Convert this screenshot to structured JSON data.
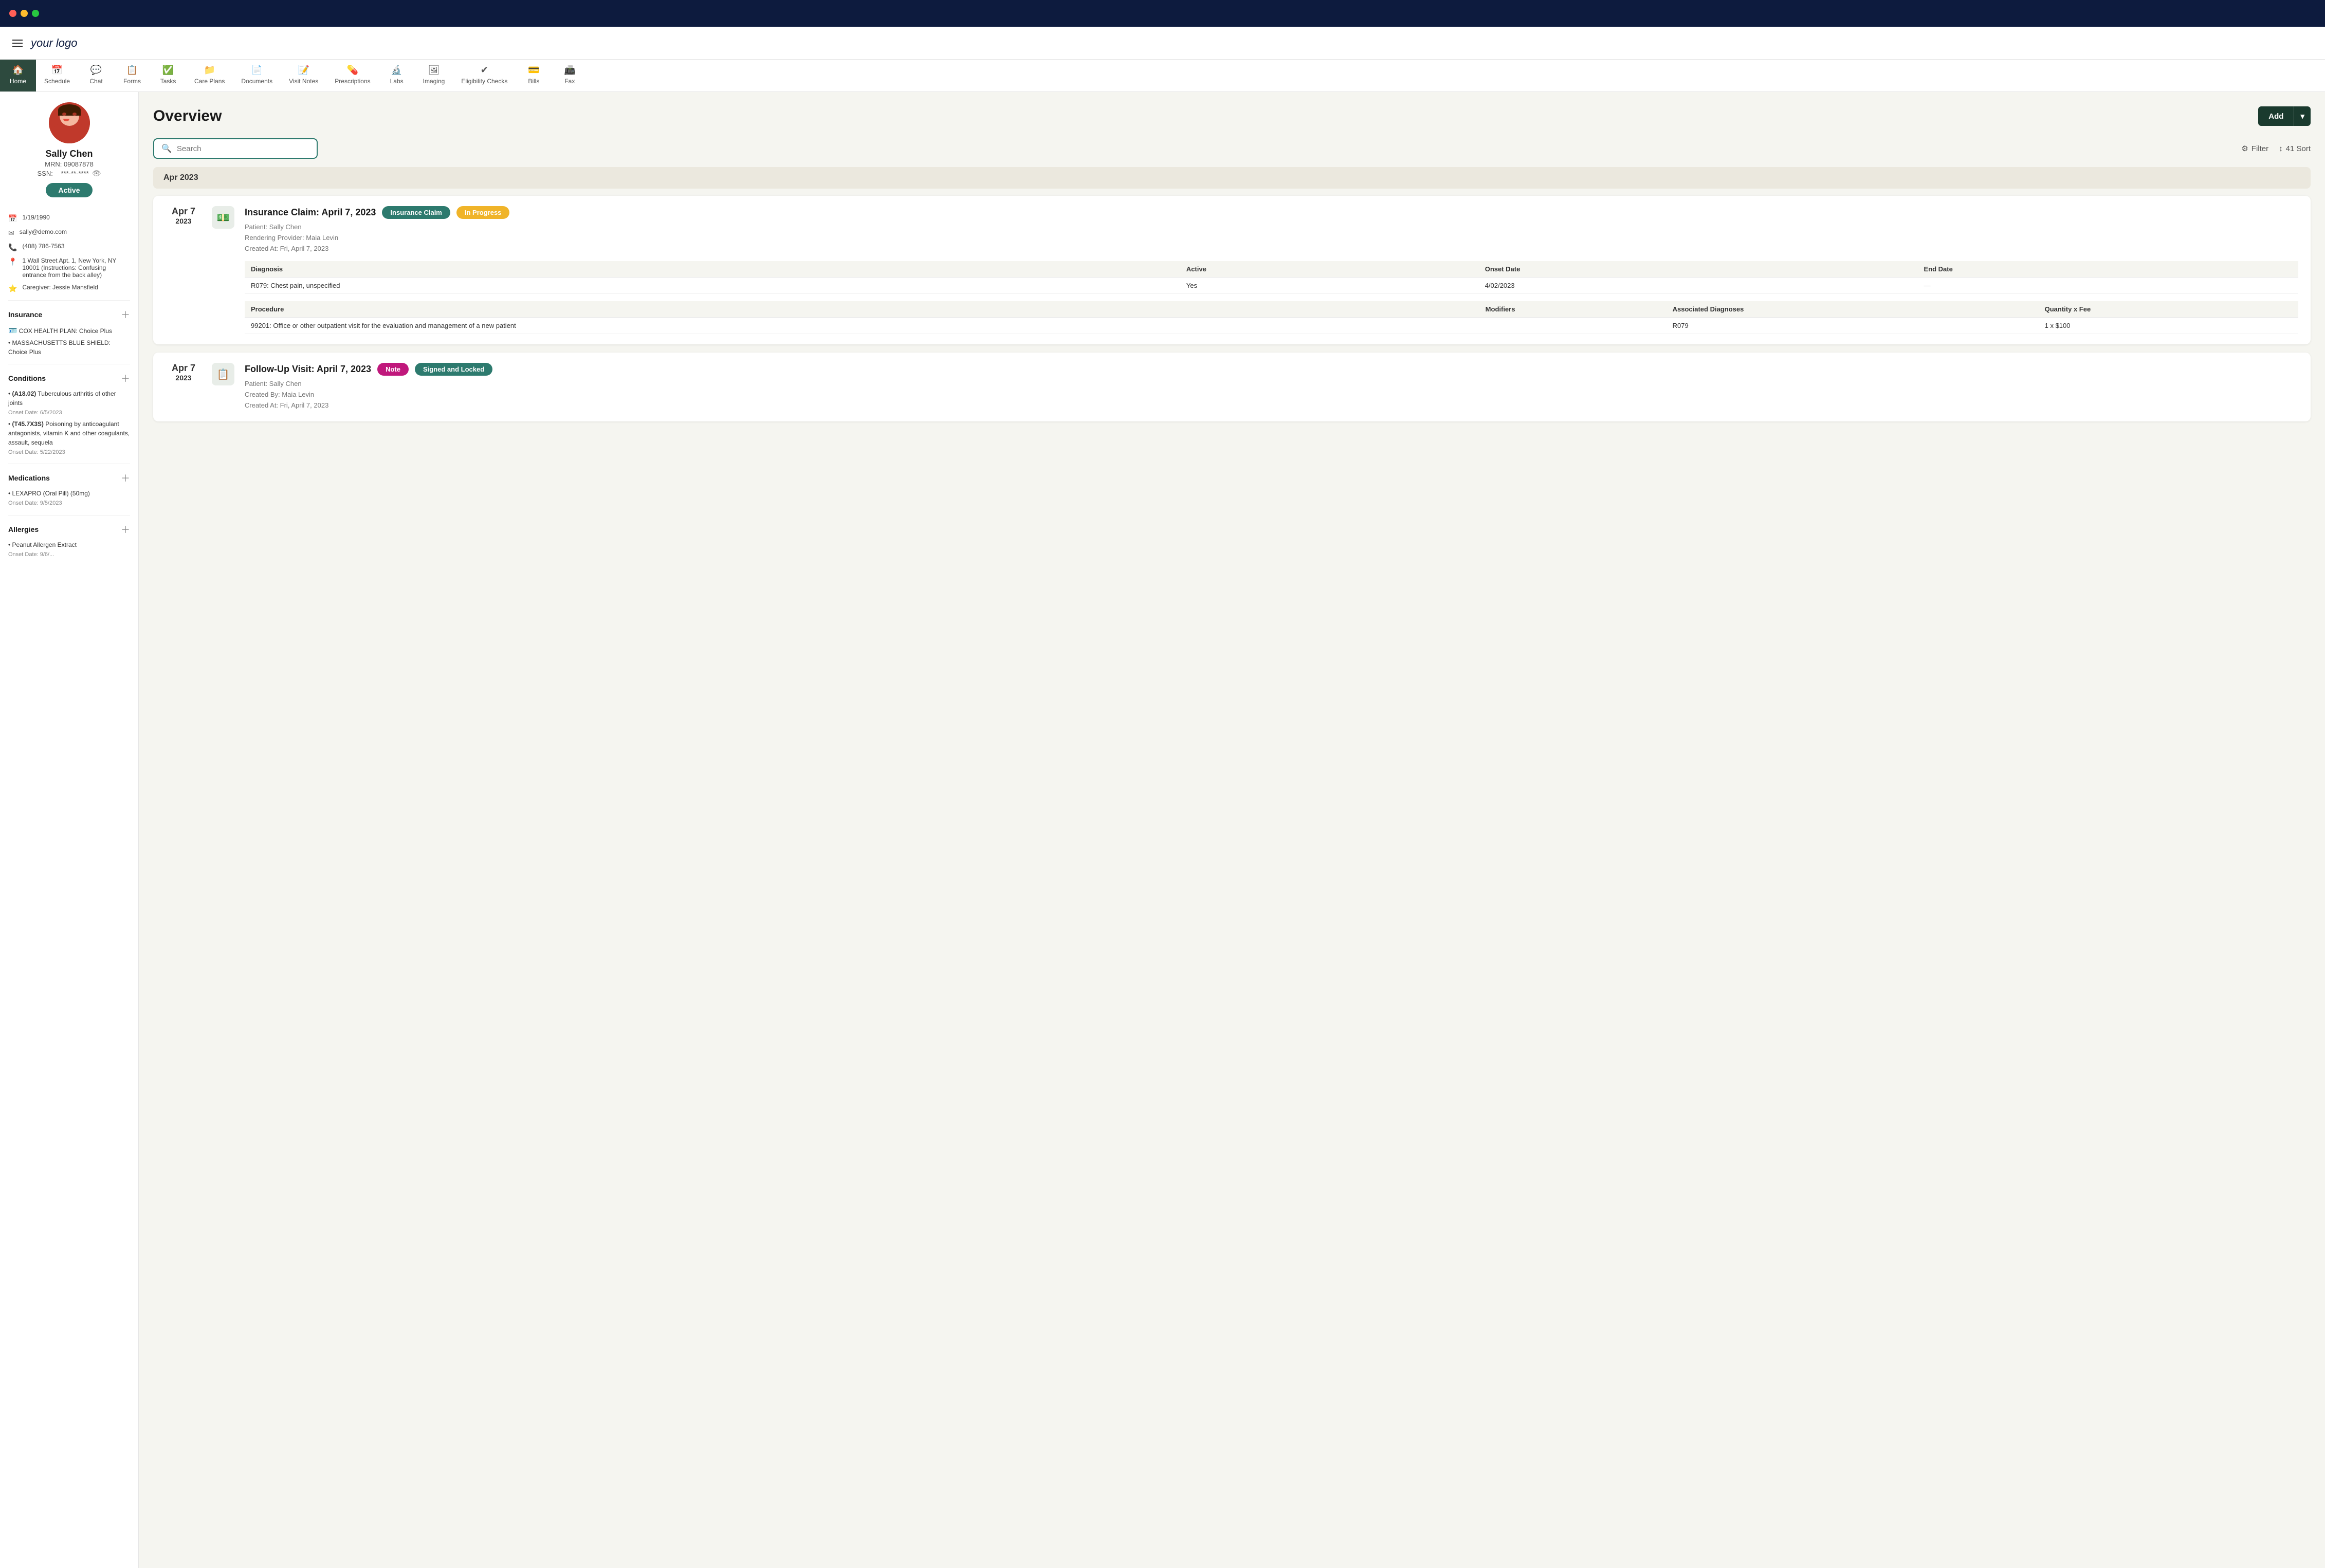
{
  "titlebar": {
    "buttons": [
      "close",
      "minimize",
      "maximize"
    ]
  },
  "topbar": {
    "logo": "your logo"
  },
  "nav": {
    "tabs": [
      {
        "id": "home",
        "label": "Home",
        "icon": "🏠",
        "active": true
      },
      {
        "id": "schedule",
        "label": "Schedule",
        "icon": "📅"
      },
      {
        "id": "chat",
        "label": "Chat",
        "icon": "💬"
      },
      {
        "id": "forms",
        "label": "Forms",
        "icon": "📋"
      },
      {
        "id": "tasks",
        "label": "Tasks",
        "icon": "✅"
      },
      {
        "id": "care-plans",
        "label": "Care Plans",
        "icon": "📁"
      },
      {
        "id": "documents",
        "label": "Documents",
        "icon": "📄"
      },
      {
        "id": "visit-notes",
        "label": "Visit Notes",
        "icon": "📝"
      },
      {
        "id": "prescriptions",
        "label": "Prescriptions",
        "icon": "💊"
      },
      {
        "id": "labs",
        "label": "Labs",
        "icon": "🔬"
      },
      {
        "id": "imaging",
        "label": "Imaging",
        "icon": "🖼"
      },
      {
        "id": "eligibility-checks",
        "label": "Eligibility Checks",
        "icon": "✔"
      },
      {
        "id": "bills",
        "label": "Bills",
        "icon": "💳"
      },
      {
        "id": "fax",
        "label": "Fax",
        "icon": "📠"
      }
    ]
  },
  "patient": {
    "name": "Sally Chen",
    "mrn_label": "MRN:",
    "mrn": "09087878",
    "ssn_label": "SSN:",
    "ssn": "***-**-****",
    "status": "Active",
    "dob": "1/19/1990",
    "email": "sally@demo.com",
    "phone": "(408) 786-7563",
    "address": "1 Wall Street Apt. 1, New York, NY 10001 (Instructions: Confusing entrance from the back alley)",
    "caregiver": "Caregiver: Jessie Mansfield"
  },
  "sidebar_sections": {
    "insurance": {
      "title": "Insurance",
      "items": [
        "COX HEALTH PLAN: Choice Plus",
        "MASSACHUSETTS BLUE SHIELD: Choice Plus"
      ]
    },
    "conditions": {
      "title": "Conditions",
      "items": [
        {
          "code": "A18.02",
          "desc": "Tuberculous arthritis of other joints",
          "onset": "Onset Date: 6/5/2023"
        },
        {
          "code": "T45.7X3S",
          "desc": "Poisoning by anticoagulant antagonists, vitamin K and other coagulants, assault, sequela",
          "onset": "Onset Date: 5/22/2023"
        }
      ]
    },
    "medications": {
      "title": "Medications",
      "items": [
        {
          "name": "LEXAPRO (Oral Pill) (50mg)",
          "onset": "Onset Date: 9/5/2023"
        }
      ]
    },
    "allergies": {
      "title": "Allergies",
      "items": [
        {
          "name": "Peanut Allergen Extract",
          "onset": "Onset Date: 9/6/..."
        }
      ]
    }
  },
  "overview": {
    "title": "Overview",
    "add_label": "Add",
    "search_placeholder": "Search",
    "filter_label": "Filter",
    "sort_label": "41 Sort",
    "date_group": "Apr 2023",
    "cards": [
      {
        "date_label": "Apr 7",
        "date_sub": "2023",
        "icon": "💵",
        "title": "Insurance Claim: April 7, 2023",
        "badge1": "Insurance Claim",
        "badge2": "In Progress",
        "patient": "Patient: Sally Chen",
        "provider": "Rendering Provider: Maia Levin",
        "created": "Created At: Fri, April 7, 2023",
        "diagnosis_table": {
          "headers": [
            "Diagnosis",
            "Active",
            "Onset Date",
            "End Date"
          ],
          "rows": [
            {
              "diagnosis": "R079: Chest pain, unspecified",
              "active": "Yes",
              "onset": "4/02/2023",
              "end": "—"
            }
          ]
        },
        "procedure_table": {
          "headers": [
            "Procedure",
            "Modifiers",
            "Associated Diagnoses",
            "Quantity x Fee"
          ],
          "rows": [
            {
              "procedure": "99201: Office or other outpatient visit for the evaluation and management of a new patient",
              "modifiers": "",
              "diagnoses": "R079",
              "fee": "1 x $100"
            }
          ]
        }
      },
      {
        "date_label": "Apr 7",
        "date_sub": "2023",
        "icon": "📋",
        "title": "Follow-Up Visit: April 7, 2023",
        "badge1": "Note",
        "badge2": "Signed and Locked",
        "patient": "Patient: Sally Chen",
        "provider": "Created By: Maia Levin",
        "created": "Created At: Fri, April 7, 2023"
      }
    ]
  }
}
